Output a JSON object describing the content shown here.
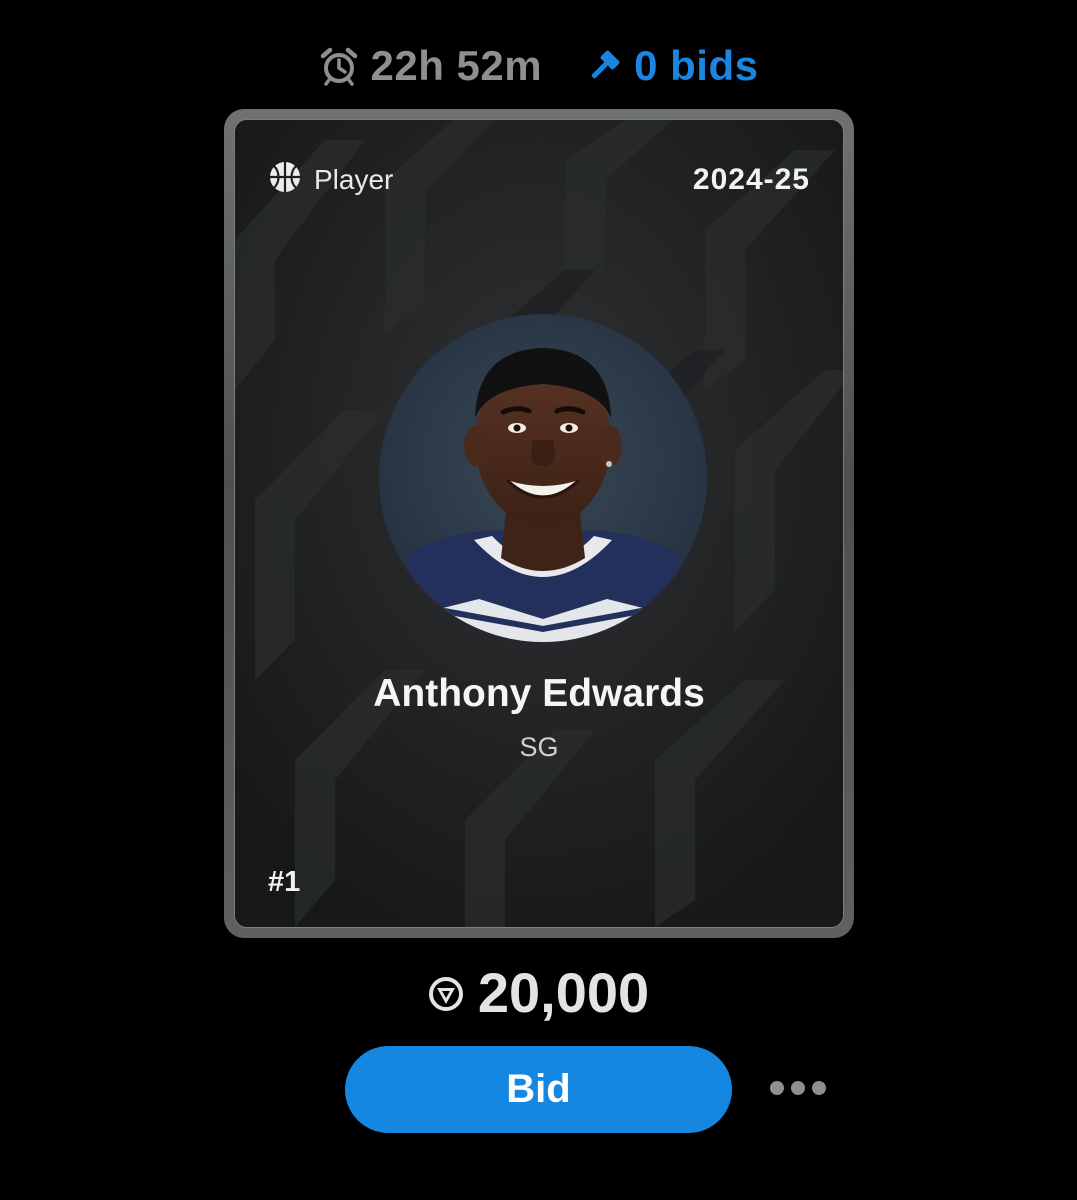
{
  "auction": {
    "time_remaining": "22h 52m",
    "bids_count": "0 bids"
  },
  "card": {
    "type_label": "Player",
    "season": "2024-25",
    "player_name": "Anthony Edwards",
    "position": "SG",
    "serial": "#1"
  },
  "price": {
    "amount": "20,000",
    "currency_icon": "coin-icon"
  },
  "actions": {
    "bid_label": "Bid",
    "more_icon": "more-dots-icon"
  },
  "colors": {
    "accent_blue": "#1687e0",
    "timer_gray": "#8e8e93",
    "background": "#000000"
  }
}
